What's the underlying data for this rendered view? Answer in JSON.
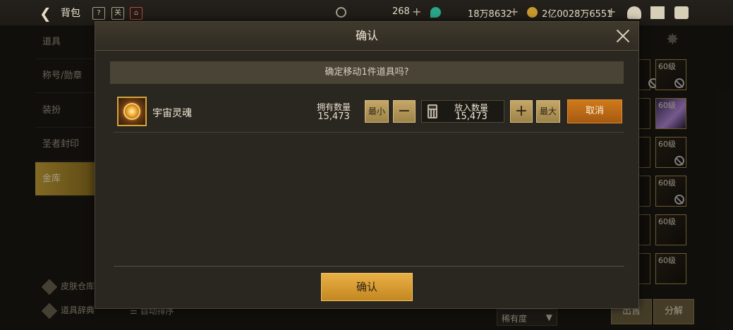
{
  "topbar": {
    "back_label": "背包",
    "currency_1": "268",
    "currency_2": "18万8632",
    "currency_3": "2亿0028万6551",
    "small_icon_2": "关",
    "accent_color": "#d6a53a"
  },
  "side_menu": {
    "items": [
      {
        "label": "道具"
      },
      {
        "label": "称号/勋章"
      },
      {
        "label": "装扮"
      },
      {
        "label": "圣者封印"
      },
      {
        "label": "金库"
      }
    ],
    "active_index": 4
  },
  "bottom_links": {
    "skin_storage": "皮肤仓库",
    "item_dict": "道具辞典",
    "auto_sort": "自动排序",
    "rarity_select": "稀有度",
    "sell_button": "出售",
    "disassemble_button": "分解"
  },
  "right_slots": {
    "level_label": "60级"
  },
  "dialog": {
    "title": "确认",
    "question": "确定移动1件道具吗?",
    "item": {
      "name": "宇宙灵魂",
      "owned_label": "拥有数量",
      "owned_value": "15,473"
    },
    "min_label": "最小",
    "max_label": "最大",
    "minus_symbol": "−",
    "plus_symbol": "+",
    "qty_label": "放入数量",
    "qty_value": "15,473",
    "cancel_label": "取消",
    "confirm_label": "确认"
  }
}
